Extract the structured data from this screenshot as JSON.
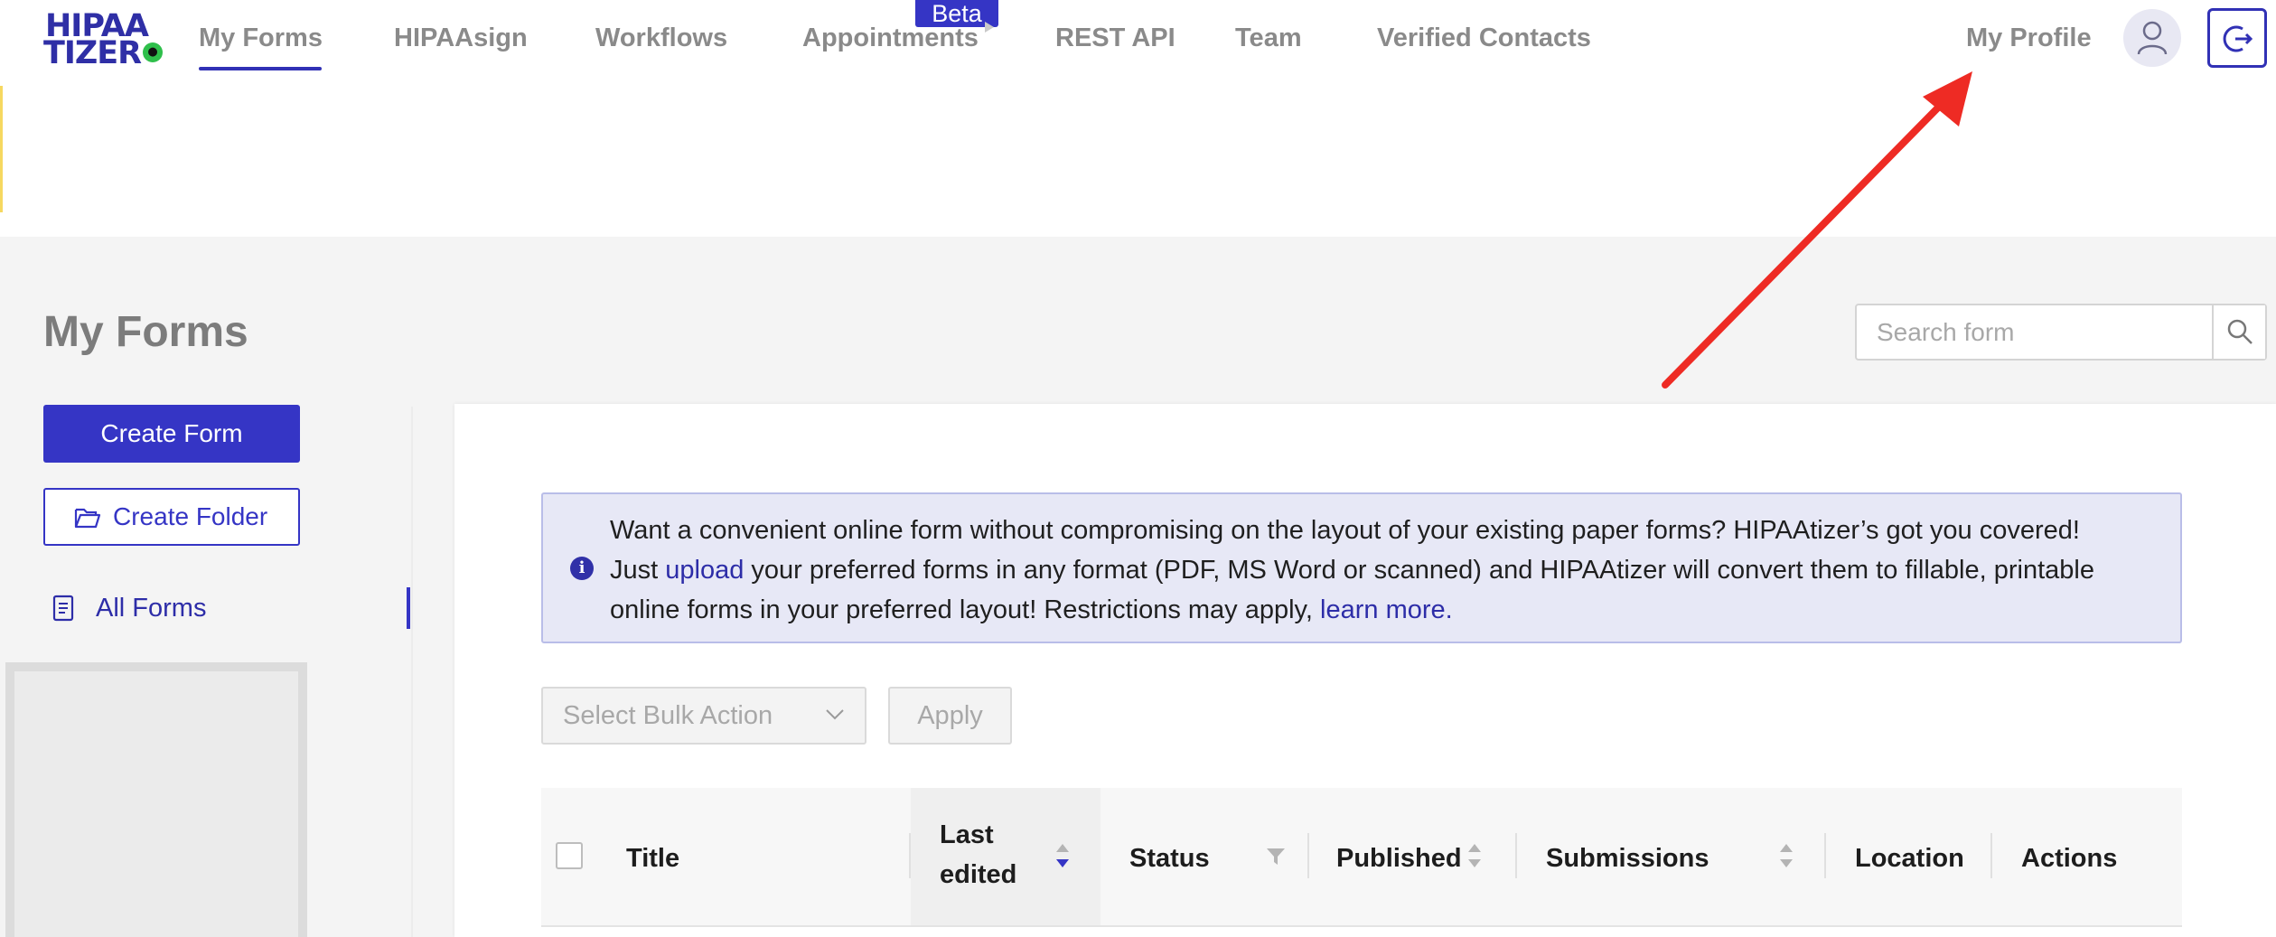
{
  "brand": {
    "logo_line1": "HIPAA",
    "logo_line2": "TIZER",
    "accent": "#3535c5"
  },
  "nav": {
    "items": [
      {
        "label": "My Forms",
        "active": true
      },
      {
        "label": "HIPAAsign"
      },
      {
        "label": "Workflows"
      },
      {
        "label": "Appointments",
        "badge": "Beta"
      },
      {
        "label": "REST API"
      },
      {
        "label": "Team"
      },
      {
        "label": "Verified Contacts"
      }
    ],
    "profile_label": "My Profile",
    "icons": {
      "avatar": "user-icon",
      "logout": "logout-icon"
    }
  },
  "page": {
    "title": "My Forms",
    "search_placeholder": "Search form"
  },
  "sidebar": {
    "create_form_label": "Create Form",
    "create_folder_label": "Create Folder",
    "all_forms_label": "All Forms"
  },
  "banner": {
    "line1": "Want a convenient online form without compromising on the layout of your existing paper forms? HIPAAtizer’s got you covered!",
    "line2_pre": "Just ",
    "line2_link": "upload",
    "line2_post": " your preferred forms in any format (PDF, MS Word or scanned) and HIPAAtizer will convert them to fillable, printable",
    "line3_pre": "online forms in your preferred layout! Restrictions may apply, ",
    "line3_link": "learn more."
  },
  "bulk": {
    "select_placeholder": "Select Bulk Action",
    "apply_label": "Apply"
  },
  "table": {
    "columns": {
      "title": "Title",
      "last_edited_1": "Last",
      "last_edited_2": "edited",
      "status": "Status",
      "published": "Published",
      "submissions": "Submissions",
      "location": "Location",
      "actions": "Actions"
    }
  },
  "annotation": {
    "arrow_color": "#ee2b24"
  }
}
